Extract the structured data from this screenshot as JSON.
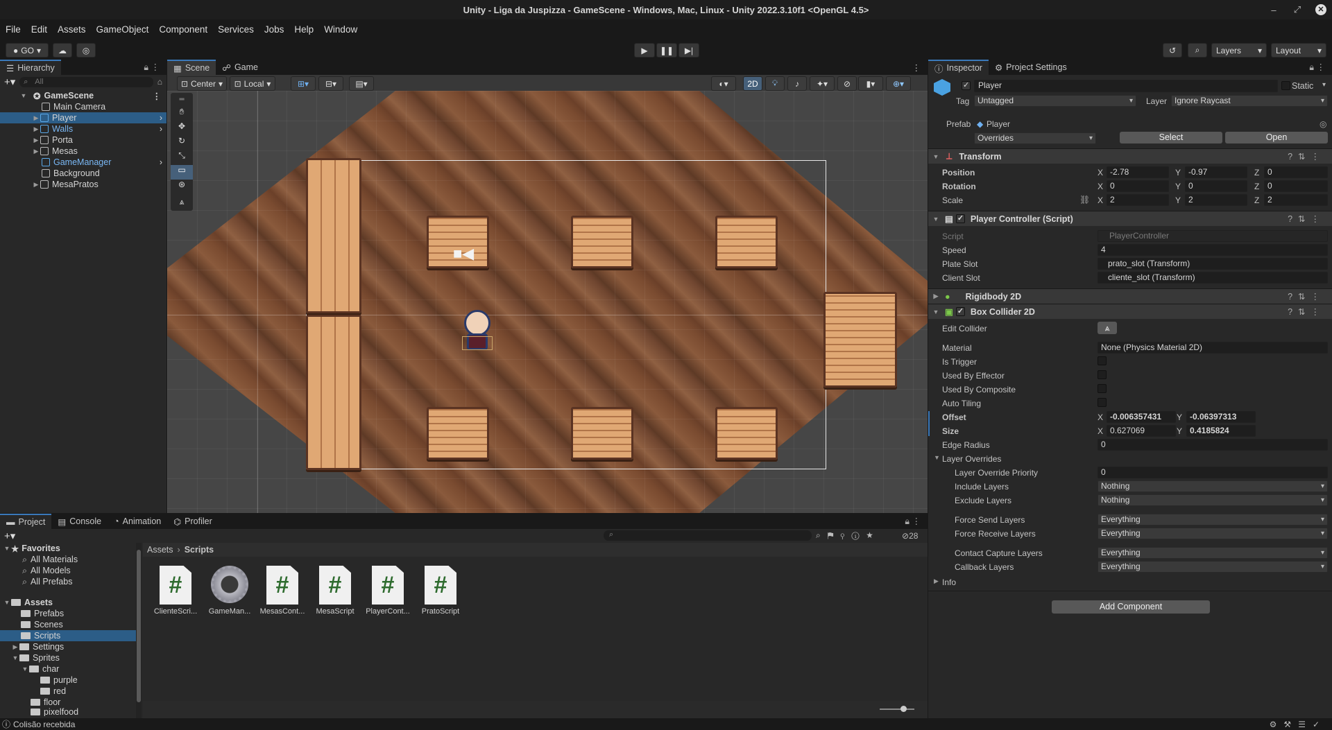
{
  "window": {
    "title": "Unity - Liga da Juspizza - GameScene - Windows, Mac, Linux - Unity 2022.3.10f1 <OpenGL 4.5>"
  },
  "menu": [
    "File",
    "Edit",
    "Assets",
    "GameObject",
    "Component",
    "Services",
    "Jobs",
    "Help",
    "Window"
  ],
  "toolbar": {
    "account": "GO",
    "layers": "Layers",
    "layout": "Layout"
  },
  "hierarchy": {
    "tab": "Hierarchy",
    "search_placeholder": "All",
    "scene": "GameScene",
    "items": [
      "Main Camera",
      "Player",
      "Walls",
      "Porta",
      "Mesas",
      "GameManager",
      "Background",
      "MesaPratos"
    ]
  },
  "scene": {
    "tabs": [
      "Scene",
      "Game"
    ],
    "pivot": "Center",
    "space": "Local",
    "mode_2d": "2D"
  },
  "inspector": {
    "tabs": [
      "Inspector",
      "Project Settings"
    ],
    "object_name": "Player",
    "static_label": "Static",
    "tag_label": "Tag",
    "tag_value": "Untagged",
    "layer_label": "Layer",
    "layer_value": "Ignore Raycast",
    "prefab_label": "Prefab",
    "prefab_value": "Player",
    "overrides": "Overrides",
    "select_btn": "Select",
    "open_btn": "Open",
    "transform": {
      "title": "Transform",
      "position_label": "Position",
      "position": [
        "-2.78",
        "-0.97",
        "0"
      ],
      "rotation_label": "Rotation",
      "rotation": [
        "0",
        "0",
        "0"
      ],
      "scale_label": "Scale",
      "scale": [
        "2",
        "2",
        "2"
      ]
    },
    "player_controller": {
      "title": "Player Controller (Script)",
      "script_label": "Script",
      "script_value": "PlayerController",
      "speed_label": "Speed",
      "speed_value": "4",
      "plate_label": "Plate Slot",
      "plate_value": "prato_slot (Transform)",
      "client_label": "Client Slot",
      "client_value": "cliente_slot (Transform)"
    },
    "rigidbody": {
      "title": "Rigidbody 2D"
    },
    "box_collider": {
      "title": "Box Collider 2D",
      "edit_collider": "Edit Collider",
      "material_label": "Material",
      "material_value": "None (Physics Material 2D)",
      "is_trigger": "Is Trigger",
      "used_by_effector": "Used By Effector",
      "used_by_composite": "Used By Composite",
      "auto_tiling": "Auto Tiling",
      "offset_label": "Offset",
      "offset": [
        "-0.006357431",
        "-0.06397313"
      ],
      "size_label": "Size",
      "size": [
        "0.627069",
        "0.4185824"
      ],
      "edge_radius_label": "Edge Radius",
      "edge_radius": "0",
      "layer_overrides": "Layer Overrides",
      "lop_label": "Layer Override Priority",
      "lop_value": "0",
      "include_label": "Include Layers",
      "include_value": "Nothing",
      "exclude_label": "Exclude Layers",
      "exclude_value": "Nothing",
      "force_send_label": "Force Send Layers",
      "force_send_value": "Everything",
      "force_receive_label": "Force Receive Layers",
      "force_receive_value": "Everything",
      "contact_capture_label": "Contact Capture Layers",
      "contact_capture_value": "Everything",
      "callback_label": "Callback Layers",
      "callback_value": "Everything",
      "info": "Info"
    },
    "add_component": "Add Component"
  },
  "project": {
    "tabs": [
      "Project",
      "Console",
      "Animation",
      "Profiler"
    ],
    "favorites": "Favorites",
    "fav_items": [
      "All Materials",
      "All Models",
      "All Prefabs"
    ],
    "assets_root": "Assets",
    "tree": [
      "Prefabs",
      "Scenes",
      "Scripts",
      "Settings",
      "Sprites",
      "char",
      "purple",
      "red",
      "floor",
      "pixelfood"
    ],
    "breadcrumb": [
      "Assets",
      "Scripts"
    ],
    "hidden_count": "28",
    "files": [
      "ClienteScri...",
      "GameMan...",
      "MesasCont...",
      "MesaScript",
      "PlayerCont...",
      "PratoScript"
    ]
  },
  "status": {
    "message": "Colisão recebida"
  }
}
